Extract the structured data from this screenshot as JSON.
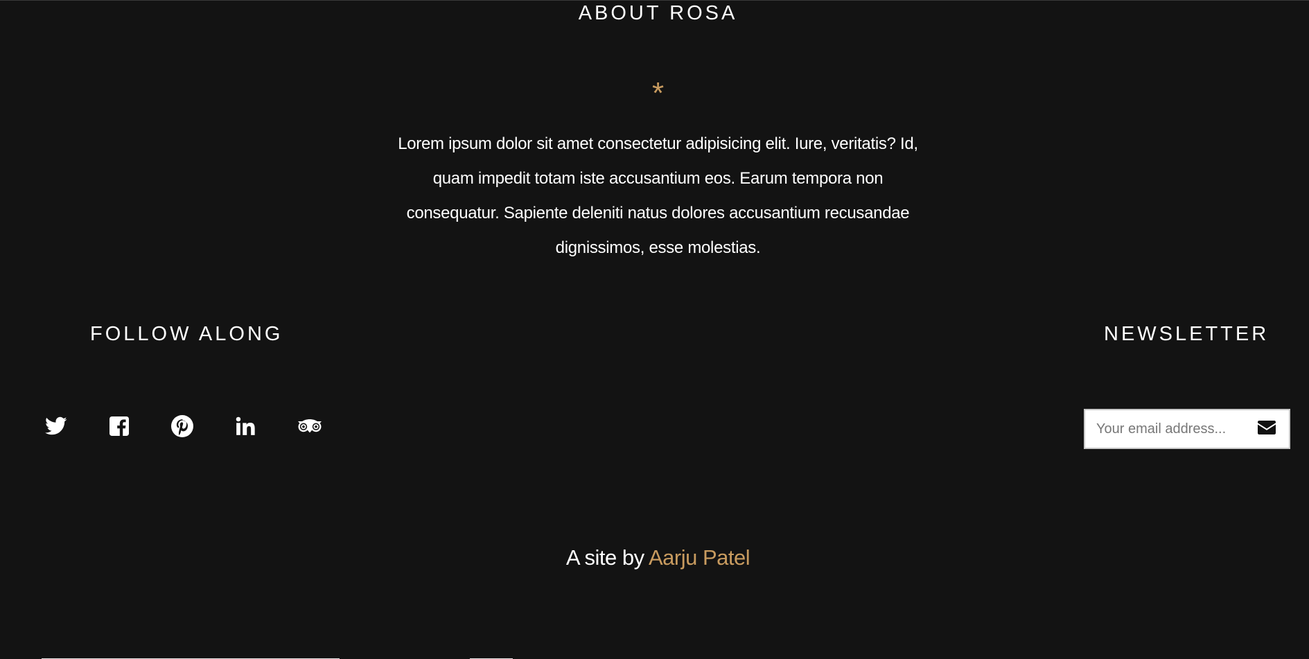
{
  "about": {
    "title": "ABOUT ROSA",
    "ornament": "*",
    "text": "Lorem ipsum dolor sit amet consectetur adipisicing elit. Iure, veritatis? Id, quam impedit totam iste accusantium eos. Earum tempora non consequatur. Sapiente deleniti natus dolores accusantium recusandae dignissimos, esse molestias."
  },
  "follow": {
    "title": "FOLLOW ALONG",
    "icons": [
      "twitter-icon",
      "facebook-icon",
      "pinterest-icon",
      "linkedin-icon",
      "tripadvisor-icon"
    ]
  },
  "newsletter": {
    "title": "NEWSLETTER",
    "placeholder": "Your email address...",
    "submit_icon": "envelope-icon"
  },
  "credit": {
    "prefix": "A site by ",
    "author": "Aarju Patel"
  },
  "colors": {
    "background": "#131313",
    "accent": "#c89b5f",
    "text": "#ffffff"
  }
}
